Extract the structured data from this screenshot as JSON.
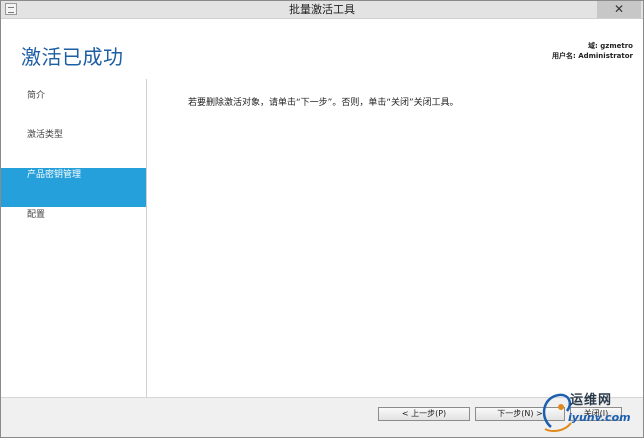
{
  "window": {
    "title": "批量激活工具",
    "close_glyph": "✕"
  },
  "header": {
    "title": "激活已成功",
    "domain_line": "域: gzmetro",
    "user_line": "用户名: Administrator"
  },
  "sidebar": {
    "items": [
      {
        "label": "简介",
        "active": false
      },
      {
        "label": "激活类型",
        "active": false
      },
      {
        "label": "产品密钥管理",
        "active": true
      },
      {
        "label": "配置",
        "active": false
      }
    ]
  },
  "main": {
    "message": "若要删除激活对象，请单击“下一步”。否则，单击“关闭”关闭工具。"
  },
  "footer": {
    "prev_label": "< 上一步(P)",
    "next_label": "下一步(N) >",
    "close_label": "关闭(I)"
  },
  "watermark": {
    "text1": "运维网",
    "text2": "iyunv.com"
  },
  "colors": {
    "accent": "#26a0da",
    "title_blue": "#1e5ea3"
  },
  "icons": [
    "app-icon",
    "close-icon"
  ]
}
